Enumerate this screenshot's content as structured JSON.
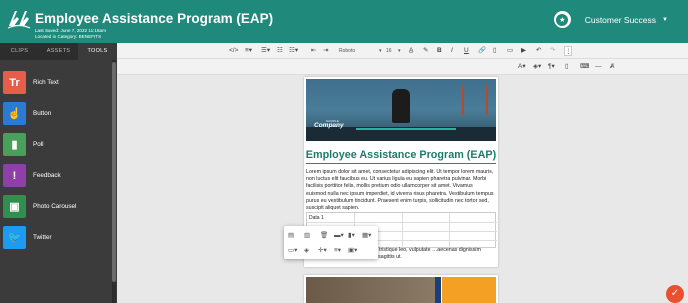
{
  "header": {
    "title": "Employee Assistance Program (EAP)",
    "last_saved": "Last Saved: June 7, 2022 11:18am",
    "category": "Located in Category: BENEFITS",
    "account_name": "Customer Success"
  },
  "left_panel": {
    "tabs": [
      {
        "label": "CLIPS"
      },
      {
        "label": "ASSETS"
      },
      {
        "label": "TOOLS"
      }
    ],
    "tools": [
      {
        "label": "Rich Text",
        "color": "#e85d4a",
        "icon": "Tr"
      },
      {
        "label": "Button",
        "color": "#2b7bd6",
        "icon": "☝"
      },
      {
        "label": "Poll",
        "color": "#4aa05a",
        "icon": "▮"
      },
      {
        "label": "Feedback",
        "color": "#8e3fa8",
        "icon": "!"
      },
      {
        "label": "Photo Carousel",
        "color": "#2f8f4f",
        "icon": "▣"
      },
      {
        "label": "Twitter",
        "color": "#1d9bf0",
        "icon": "🐦"
      }
    ]
  },
  "toolbar": {
    "font_family": "Roboto",
    "font_size": "16"
  },
  "document": {
    "hero_sample": "SAMPLE",
    "hero_company": "Company",
    "title": "Employee Assistance Program (EAP)",
    "paragraph": "Lorem ipsum dolor sit amet, consectetur adipiscing elit. Ut tempor lorem mauris, non luctus elit faucibus eu. Ut varius ligula eu sapien pharetra pulvinar. Morbi facilisis porttitor felis, mollis pretium odio ullamcorper sit amet. Vivamus euismod nulla nec ipsum imperdiet, id viverra risus pharetra. Vestibulum tempus purus eu vestibulum tincidunt. Praesent enim turpis, sollicitudin nec tortor sed, suscipit aliquet sapien.",
    "table_cell": "Data 1",
    "paragraph2": "…mentum hendrerit, est purus tristique leo, vulputate …aecenas dignissim ultrices nisl, eu tincidunt turpis sagittis ut."
  }
}
